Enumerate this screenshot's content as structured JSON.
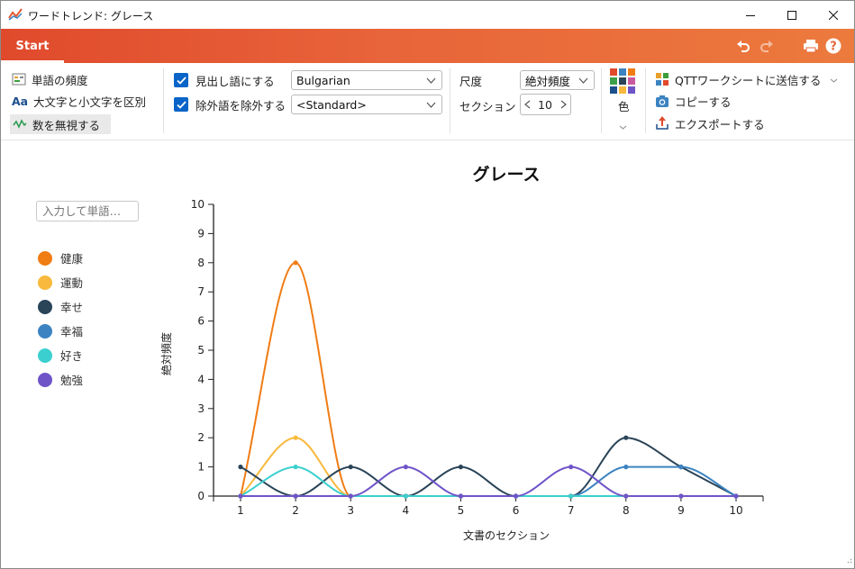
{
  "window": {
    "title": "ワードトレンド: グレース"
  },
  "ribbon": {
    "tab_start": "Start"
  },
  "toolbar": {
    "word_frequency": "単語の頻度",
    "case_sensitive": "大文字と小文字を区別",
    "ignore_numbers": "数を無視する",
    "lemmatize_label": "見出し語にする",
    "lemmatize_checked": true,
    "language": "Bulgarian",
    "exclude_label": "除外語を除外する",
    "exclude_checked": true,
    "exclude_list": "<Standard>",
    "scale_label": "尺度",
    "scale_value": "絶対頻度",
    "section_label": "セクション",
    "section_value": "10",
    "color_label": "色",
    "send_qtt": "QTTワークシートに送信する",
    "copy": "コピーする",
    "export": "エクスポートする"
  },
  "sidebar": {
    "search_placeholder": "入力して単語…",
    "legend": [
      {
        "label": "健康",
        "color": "#f07c14"
      },
      {
        "label": "運動",
        "color": "#f8b93c"
      },
      {
        "label": "幸せ",
        "color": "#2a4458"
      },
      {
        "label": "幸福",
        "color": "#3b83c1"
      },
      {
        "label": "好き",
        "color": "#3ccfcf"
      },
      {
        "label": "勉強",
        "color": "#6f54c8"
      }
    ]
  },
  "chart_data": {
    "type": "line",
    "title": "グレース",
    "xlabel": "文書のセクション",
    "ylabel": "絶対頻度",
    "categories": [
      1,
      2,
      3,
      4,
      5,
      6,
      7,
      8,
      9,
      10
    ],
    "ylim": [
      0,
      10
    ],
    "yticks": [
      0,
      1,
      2,
      3,
      4,
      5,
      6,
      7,
      8,
      9,
      10
    ],
    "grid": false,
    "legend": "left",
    "series": [
      {
        "name": "健康",
        "color": "#f07c14",
        "values": [
          0,
          8,
          0,
          0,
          0,
          0,
          0,
          0,
          0,
          0
        ]
      },
      {
        "name": "運動",
        "color": "#f8b93c",
        "values": [
          0,
          2,
          0,
          0,
          0,
          0,
          0,
          0,
          0,
          0
        ]
      },
      {
        "name": "幸せ",
        "color": "#2a4458",
        "values": [
          1,
          0,
          1,
          0,
          1,
          0,
          0,
          2,
          1,
          0
        ]
      },
      {
        "name": "幸福",
        "color": "#3b83c1",
        "values": [
          0,
          0,
          0,
          0,
          0,
          0,
          0,
          1,
          1,
          0
        ]
      },
      {
        "name": "好き",
        "color": "#3ccfcf",
        "values": [
          0,
          1,
          0,
          0,
          0,
          0,
          0,
          0,
          0,
          0
        ]
      },
      {
        "name": "勉強",
        "color": "#6f54c8",
        "values": [
          0,
          0,
          0,
          1,
          0,
          0,
          1,
          0,
          0,
          0
        ]
      }
    ]
  }
}
